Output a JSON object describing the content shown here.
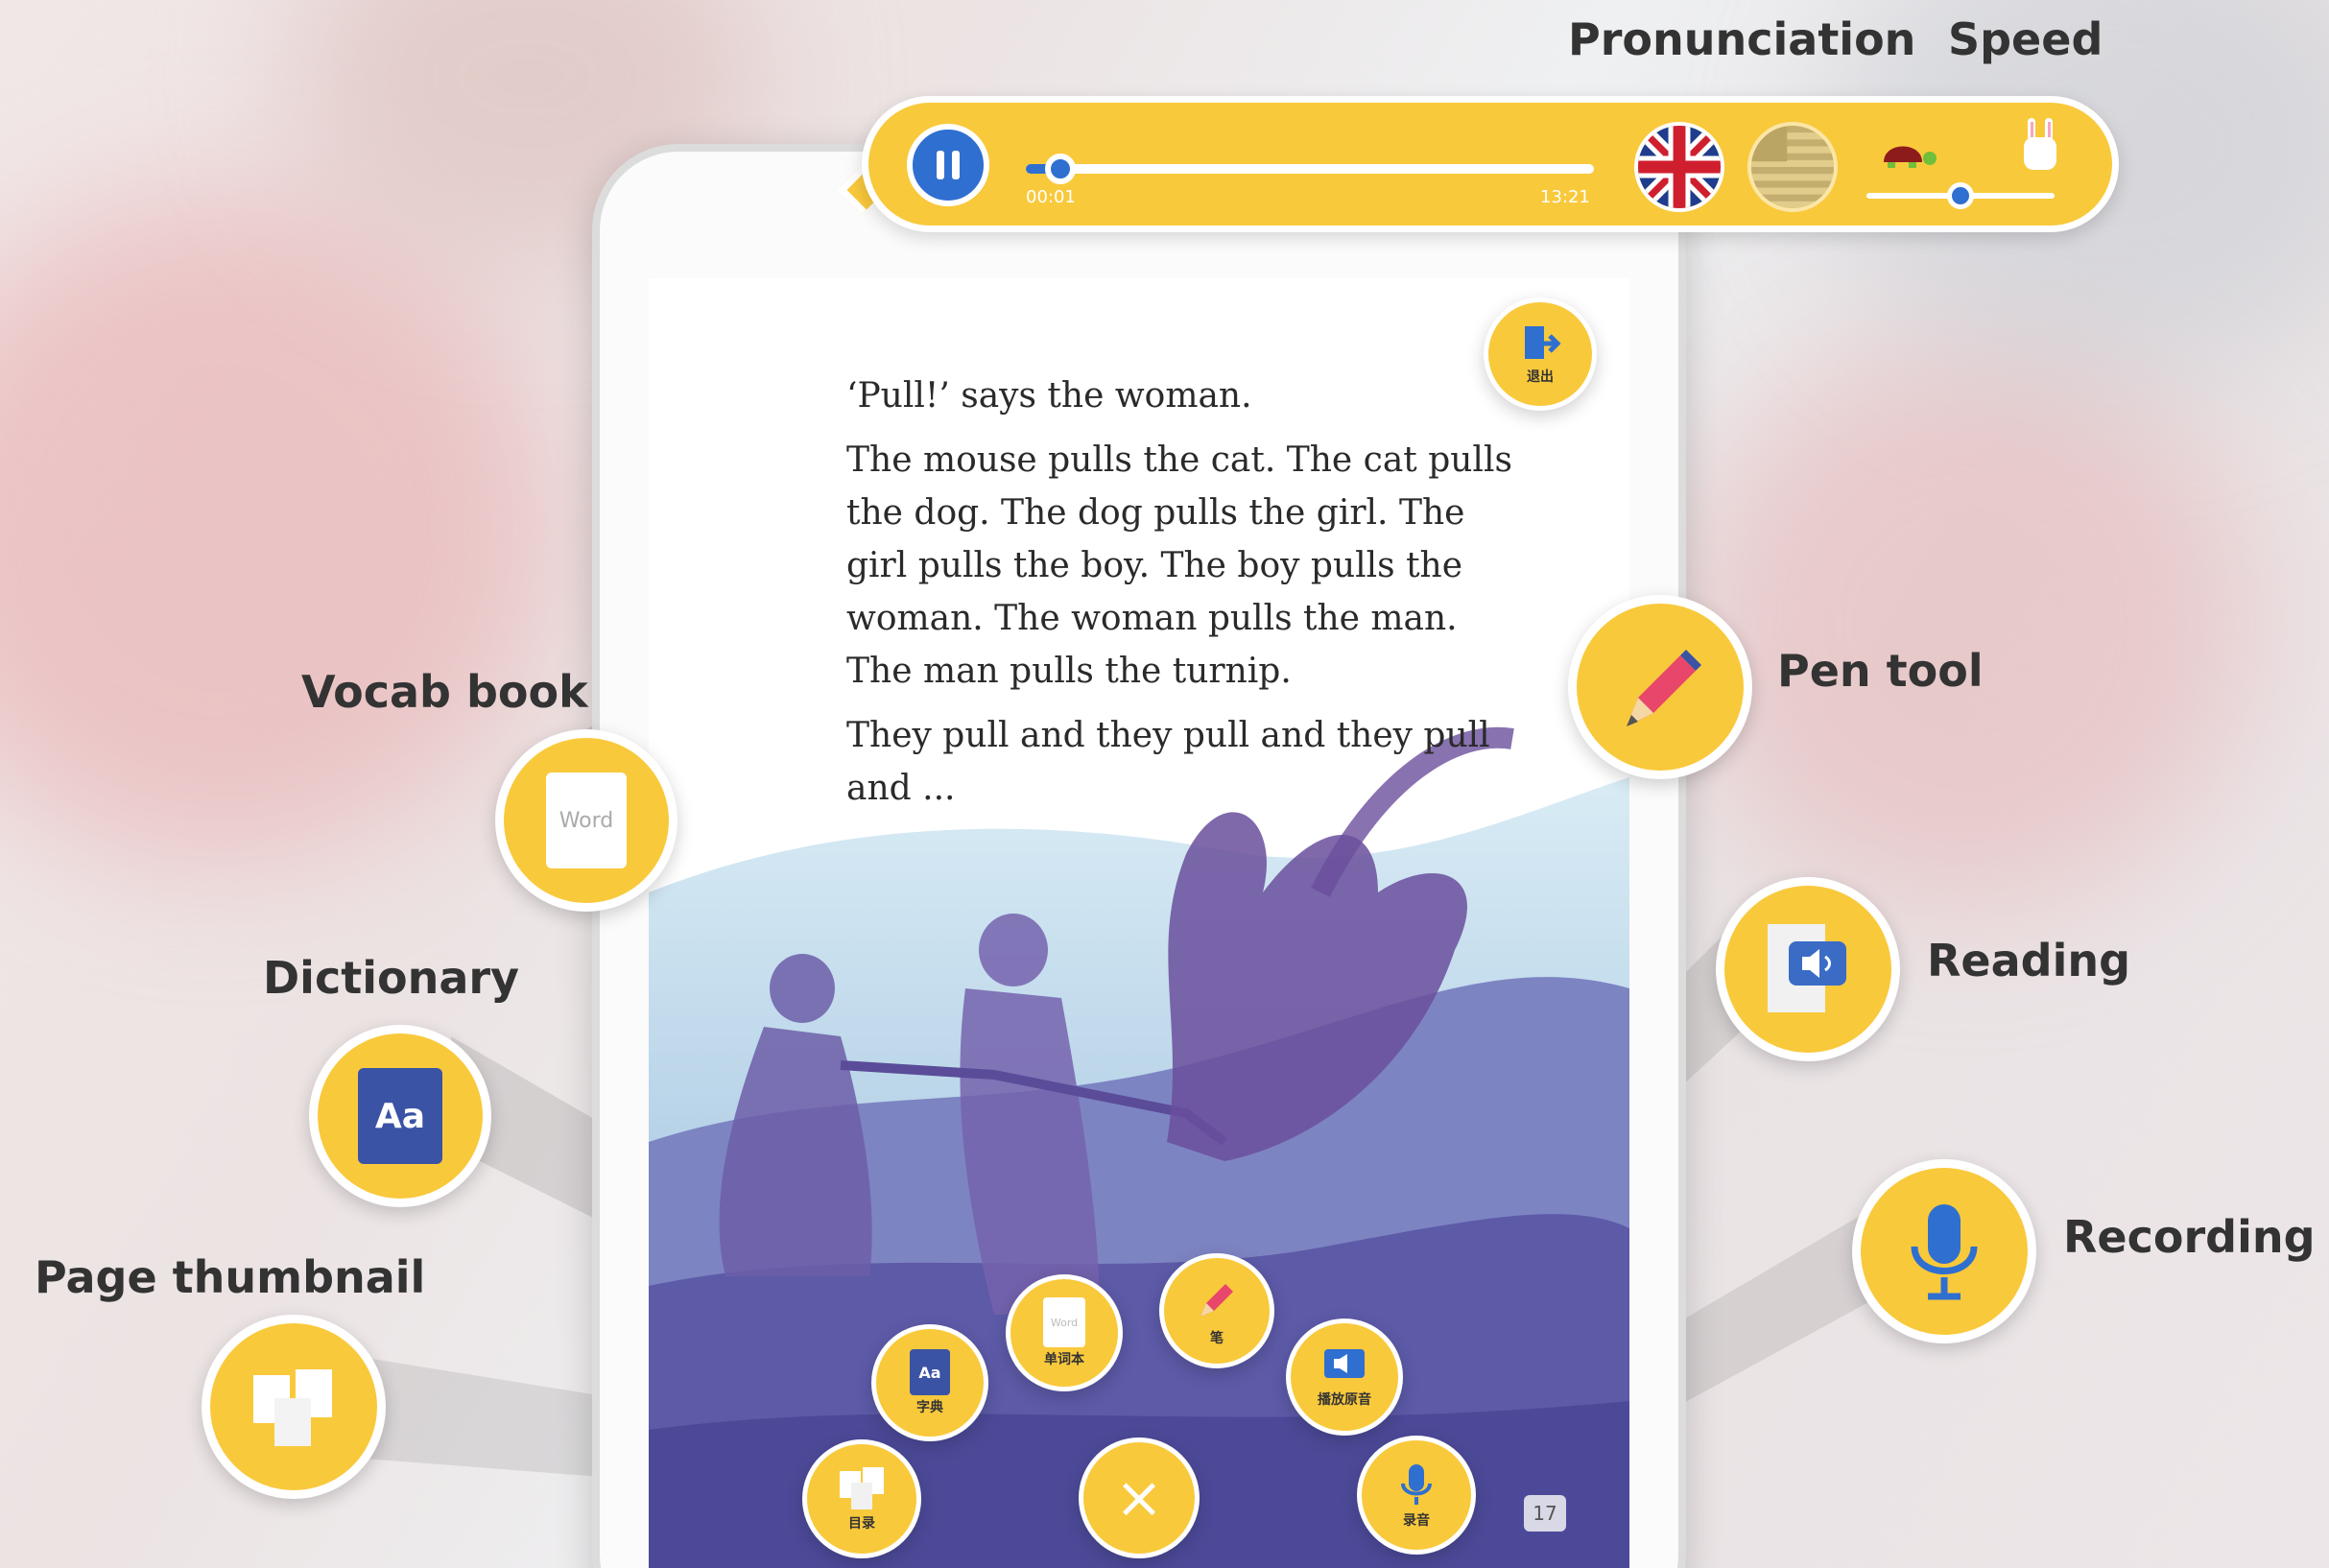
{
  "labels": {
    "pronunciation": "Pronunciation",
    "speed": "Speed",
    "vocab_book": "Vocab book",
    "dictionary": "Dictionary",
    "page_thumbnail": "Page thumbnail",
    "pen_tool": "Pen tool",
    "reading": "Reading",
    "recording": "Recording"
  },
  "audio_player": {
    "current_time": "00:01",
    "total_time": "13:21",
    "progress": 0.06,
    "speed_level": 0.5
  },
  "story": {
    "paragraphs": [
      "‘Pull!’ says the woman.",
      "The mouse pulls the cat. The cat pulls the dog. The dog pulls the girl. The girl pulls the boy. The boy pulls the woman. The woman pulls the man. The man pulls the turnip.",
      "They pull and they pull and they pull and ..."
    ],
    "page_number": "17"
  },
  "screen_buttons": {
    "exit": "退出",
    "vocab": "单词本",
    "vocab_icon_text": "Word",
    "pen": "笔",
    "dictionary": "字典",
    "dictionary_icon_text": "Aa",
    "reading": "播放原音",
    "thumbnail": "目录",
    "recording": "录音",
    "close": "×"
  },
  "colors": {
    "accent_yellow": "#f9c93c",
    "primary_blue": "#2f6fd0",
    "dictionary_blue": "#3a53a4",
    "illustration_purple": "#5d5aa8"
  }
}
